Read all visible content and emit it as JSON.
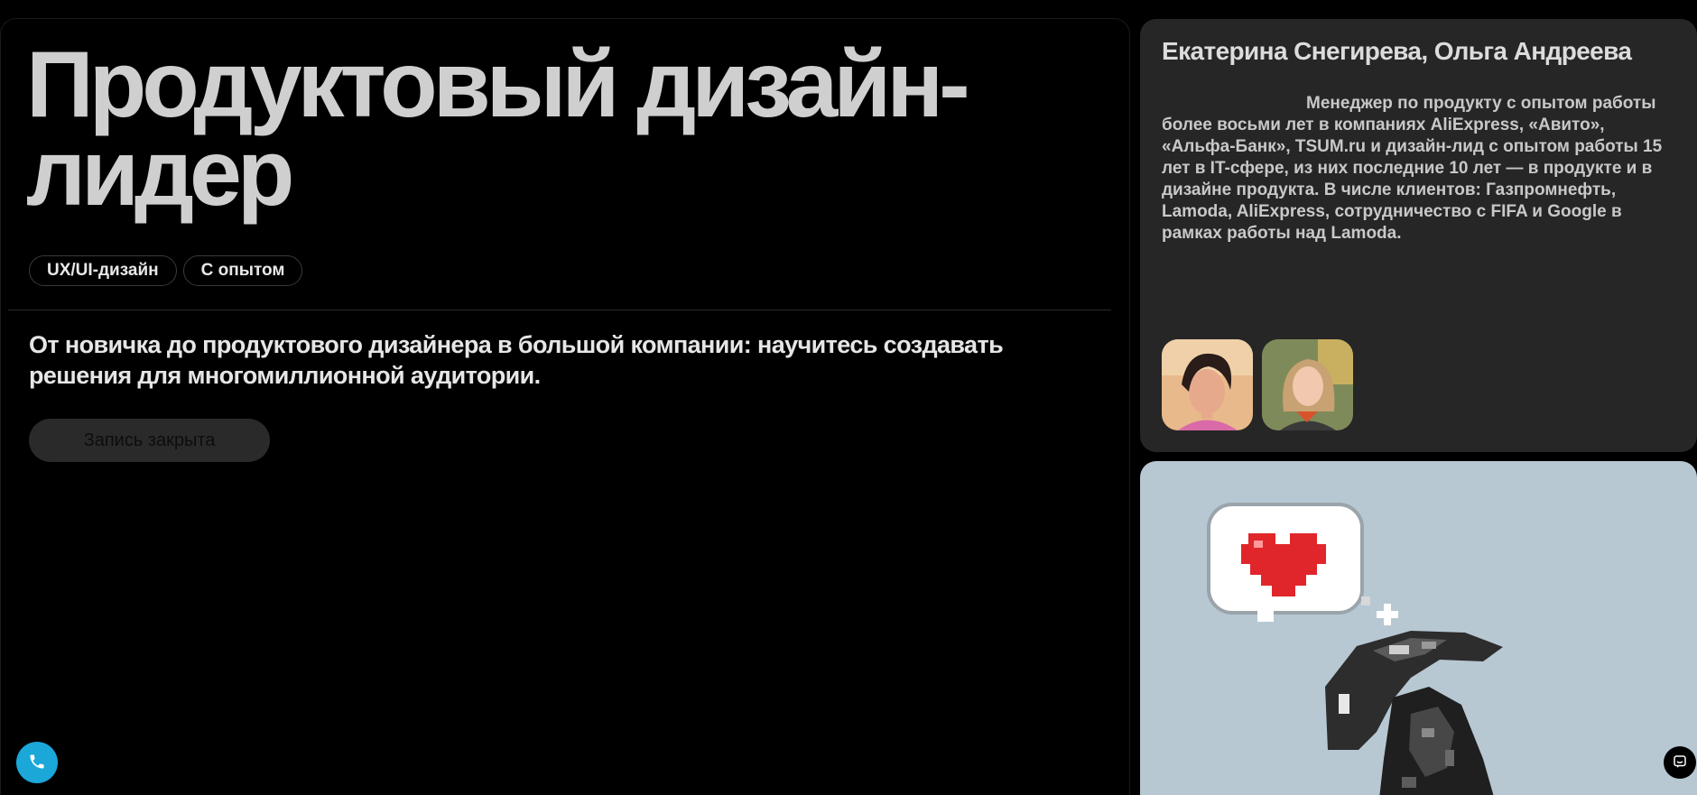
{
  "course": {
    "title": "Продуктовый дизайн-лидер",
    "tags": [
      "UX/UI-дизайн",
      "С опытом"
    ],
    "description": "От новичка до продуктового дизайнера в большой компании: научитесь создавать решения для многомиллионной аудитории.",
    "enroll_label": "Запись закрыта"
  },
  "authors": {
    "names": "Екатерина Снегирева, Ольга Андреева",
    "bio": "Менеджер по продукту с опытом работы более восьми лет в компаниях AliExpress, «Авито», «Альфа-Банк», TSUM.ru и дизайн-лид с опытом работы 15 лет в IT-сфере, из них последние 10 лет — в продукте и в дизайне продукта. В числе клиентов: Газпромнефть, Lamoda, AliExpress, сотрудничество с FIFA и Google в рамках работы над Lamoda."
  },
  "colors": {
    "page_bg": "#000000",
    "card_bg": "#262626",
    "illustration_bg": "#b7c8d3",
    "call_button": "#1ba7d8",
    "heart": "#e0262b"
  },
  "icons": {
    "call": "phone-icon",
    "chat": "chat-icon"
  }
}
